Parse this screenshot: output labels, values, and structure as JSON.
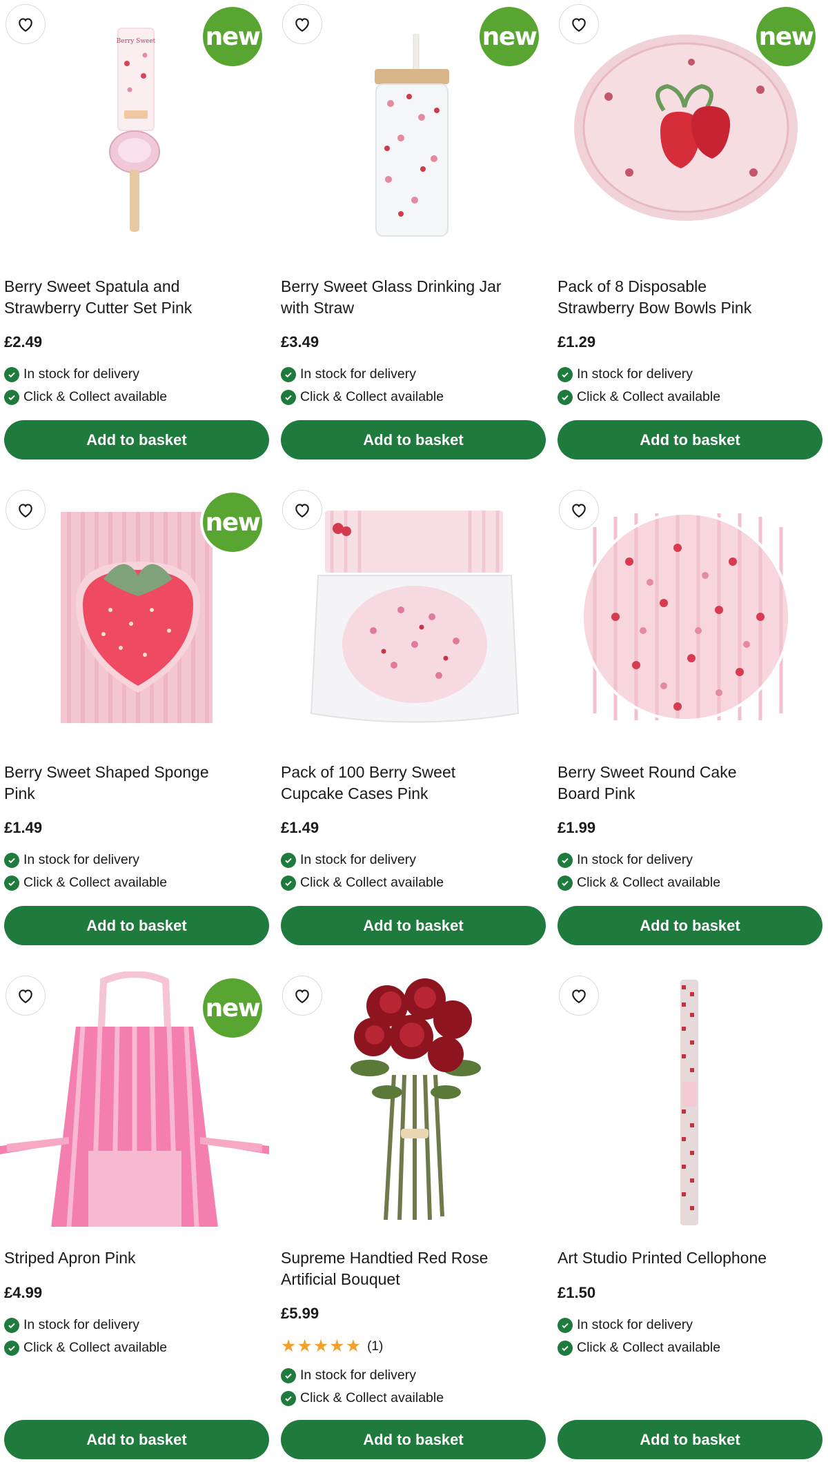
{
  "colors": {
    "brand_green": "#1f7a3d",
    "new_badge": "#59a532"
  },
  "products": [
    {
      "title_line1": "Berry Sweet Spatula and",
      "title_line2": "Strawberry Cutter Set Pink",
      "price": "£2.49",
      "badge": "new",
      "stock": "In stock for delivery",
      "collect": "Click & Collect available",
      "button": "Add to basket",
      "image": "spatula-cutter-set"
    },
    {
      "title_line1": "Berry Sweet Glass Drinking Jar",
      "title_line2": "with Straw",
      "price": "£3.49",
      "badge": "new",
      "stock": "In stock for delivery",
      "collect": "Click & Collect available",
      "button": "Add to basket",
      "image": "glass-jar"
    },
    {
      "title_line1": "Pack of 8 Disposable",
      "title_line2": "Strawberry Bow Bowls Pink",
      "price": "£1.29",
      "badge": "new",
      "stock": "In stock for delivery",
      "collect": "Click & Collect available",
      "button": "Add to basket",
      "image": "paper-bowl"
    },
    {
      "title_line1": "Berry Sweet Shaped Sponge",
      "title_line2": "Pink",
      "price": "£1.49",
      "badge": "new",
      "stock": "In stock for delivery",
      "collect": "Click & Collect available",
      "button": "Add to basket",
      "image": "strawberry-sponge"
    },
    {
      "title_line1": "Pack of 100 Berry Sweet",
      "title_line2": "Cupcake Cases Pink",
      "price": "£1.49",
      "badge": "",
      "stock": "In stock for delivery",
      "collect": "Click & Collect available",
      "button": "Add to basket",
      "image": "cupcake-cases"
    },
    {
      "title_line1": "Berry Sweet Round Cake",
      "title_line2": "Board Pink",
      "price": "£1.99",
      "badge": "",
      "stock": "In stock for delivery",
      "collect": "Click & Collect available",
      "button": "Add to basket",
      "image": "cake-board"
    },
    {
      "title_line1": "Striped Apron Pink",
      "title_line2": "",
      "price": "£4.99",
      "badge": "new",
      "stock": "In stock for delivery",
      "collect": "Click & Collect available",
      "button": "Add to basket",
      "image": "striped-apron"
    },
    {
      "title_line1": "Supreme Handtied Red Rose",
      "title_line2": "Artificial Bouquet",
      "price": "£5.99",
      "badge": "",
      "rating": 5,
      "rating_count": "(1)",
      "stock": "In stock for delivery",
      "collect": "Click & Collect available",
      "button": "Add to basket",
      "image": "rose-bouquet"
    },
    {
      "title_line1": "Art Studio Printed Cellophone",
      "title_line2": "",
      "price": "£1.50",
      "badge": "",
      "stock": "In stock for delivery",
      "collect": "Click & Collect available",
      "button": "Add to basket",
      "image": "cellophane-roll"
    }
  ]
}
